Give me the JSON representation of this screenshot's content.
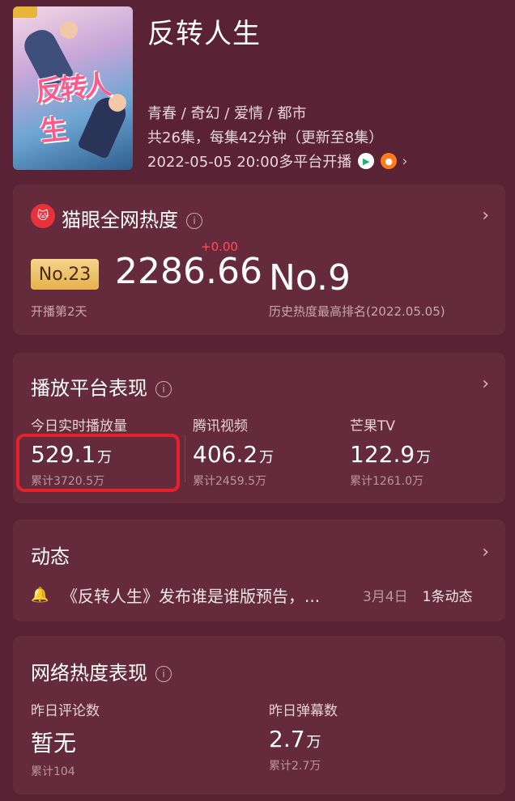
{
  "show": {
    "title": "反转人生",
    "genres": "青春 / 奇幻 / 爱情 / 都市",
    "episodes": "共26集，每集42分钟（更新至8集）",
    "release": "2022-05-05 20:00多平台开播"
  },
  "heat_card": {
    "title": "猫眼全网热度",
    "rank": "No.23",
    "value": "2286.66",
    "delta": "+0.00",
    "since_start": "开播第2天",
    "best_rank": "No.9",
    "best_rank_note": "历史热度最高排名(2022.05.05)"
  },
  "platform_card": {
    "title": "播放平台表现",
    "stats": [
      {
        "label": "今日实时播放量",
        "value": "529.1",
        "unit": "万",
        "total": "累计3720.5万"
      },
      {
        "label": "腾讯视频",
        "value": "406.2",
        "unit": "万",
        "total": "累计2459.5万"
      },
      {
        "label": "芒果TV",
        "value": "122.9",
        "unit": "万",
        "total": "累计1261.0万"
      }
    ]
  },
  "news_card": {
    "title": "动态",
    "item_text": "《反转人生》发布谁是谁版预告，...",
    "item_date": "3月4日",
    "item_count": "1条动态"
  },
  "network_card": {
    "title": "网络热度表现",
    "stats": [
      {
        "label": "昨日评论数",
        "value": "暂无",
        "unit": "",
        "total": "累计104"
      },
      {
        "label": "昨日弹幕数",
        "value": "2.7",
        "unit": "万",
        "total": "累计2.7万"
      }
    ]
  },
  "colors": {
    "background": "#5a2335",
    "card": "#652b3d",
    "rank_badge": "#e5b14e",
    "delta": "#ff4d5e",
    "highlight": "#e5222c"
  },
  "icons": [
    "tencent-video-icon",
    "mango-tv-icon",
    "maoyan-cat-icon",
    "info-icon",
    "chevron-right-icon",
    "bell-icon"
  ]
}
